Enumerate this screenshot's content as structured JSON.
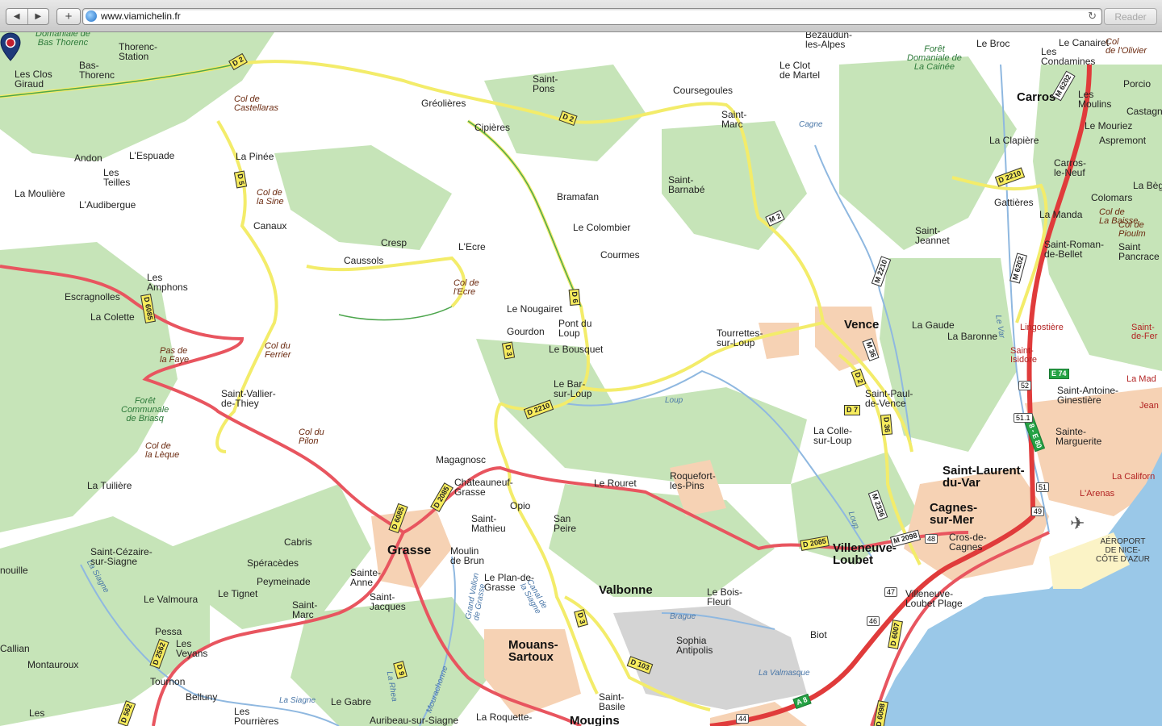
{
  "browser": {
    "back_icon": "back-arrow-icon",
    "forward_icon": "forward-arrow-icon",
    "add_label": "+",
    "url": "www.viamichelin.fr",
    "reload_icon": "reload-icon",
    "reader_label": "Reader"
  },
  "colors": {
    "land": "#ffffff",
    "forest": "#bfe0b0",
    "urban": "#f6d2b4",
    "sea": "#9ac8e8",
    "major_road": "#e8555f",
    "secondary_road": "#f3ec6a",
    "green_border": "#4da64d",
    "motorway": "#e03b3b"
  },
  "marker": {
    "icon": "map-pin-icon",
    "color": "#1e3a7a"
  },
  "towns": {
    "domaniale": "Domaniale de\nBas Thorenc",
    "thorenc_station": "Thorenc-\nStation",
    "bas_thorenc": "Bas-\nThorenc",
    "les_clos": "Les Clos\nGiraud",
    "greolieres": "Gréolières",
    "saint_pons": "Saint-\nPons",
    "coursegoules": "Coursegoules",
    "bezaudun": "Bezaudun-\nles-Alpes",
    "le_clot": "Le Clot\nde Martel",
    "le_broc": "Le Broc",
    "le_canairet": "Le Canairet",
    "les_condamines": "Les\nCondamines",
    "carros": "Carros",
    "les_moulins": "Les\nMoulins",
    "porcio": "Porcio",
    "castagn": "Castagn",
    "le_mouriez": "Le Mouriez",
    "aspremont": "Aspremont",
    "cipieres": "Cipières",
    "saint_marc_top": "Saint-\nMarc",
    "andon": "Andon",
    "lespuade": "L'Espuade",
    "les_teilles": "Les\nTeilles",
    "la_pinee": "La Pinée",
    "la_clapiere": "La Clapière",
    "carros_le_neuf": "Carros-\nle-Neuf",
    "saint_barnabe": "Saint-\nBarnabé",
    "bramafan": "Bramafan",
    "la_mouliere": "La Moulière",
    "laudibergue": "L'Audibergue",
    "gattieres": "Gattières",
    "la_bege": "La Bèg",
    "colomars": "Colomars",
    "la_manda": "La Manda",
    "canaux": "Canaux",
    "le_colombier": "Le Colombier",
    "cresp": "Cresp",
    "caussols": "Caussols",
    "lecre": "L'Ecre",
    "coursmes": "Courmes",
    "saint_jeannet": "Saint-\nJeannet",
    "saint_roman": "Saint-Roman-\nde-Bellet",
    "saint_pancrace": "Saint\nPancrace",
    "escragnolles": "Escragnolles",
    "les_amphons": "Les\nAmphons",
    "la_colette": "La Colette",
    "le_nougairet": "Le Nougairet",
    "gourdon": "Gourdon",
    "pont_du_loup": "Pont du\nLoup",
    "tourrettes": "Tourrettes-\nsur-Loup",
    "vence": "Vence",
    "la_gaude": "La Gaude",
    "la_baronne": "La Baronne",
    "le_bousquet": "Le Bousquet",
    "le_bar": "Le Bar-\nsur-Loup",
    "saint_vallier": "Saint-Vallier-\nde-Thiey",
    "saint_paul": "Saint-Paul-\nde-Vence",
    "saint_antoine": "Saint-Antoine-\nGinestière",
    "la_colle": "La Colle-\nsur-Loup",
    "sainte_marguerite": "Sainte-\nMarguerite",
    "magagnosc": "Magagnosc",
    "chateauneuf": "Châteauneuf-\nGrasse",
    "le_rouret": "Le Rouret",
    "roquefort": "Roquefort-\nles-Pins",
    "la_tuiliere": "La Tuilière",
    "saint_laurent": "Saint-Laurent-\ndu-Var",
    "opio": "Opio",
    "saint_mathieu": "Saint-\nMathieu",
    "san_peire": "San\nPeire",
    "cagnes": "Cagnes-\nsur-Mer",
    "cabris": "Cabris",
    "grasse": "Grasse",
    "moulin_de_brun": "Moulin\nde Brun",
    "villeneuve_loubet": "Villeneuve-\nLoubet",
    "cros_de_cagnes": "Cros-de-\nCagnes",
    "saint_cezaire": "Saint-Cézaire-\nsur-Siagne",
    "speracedes": "Spéracèdes",
    "peymeinade": "Peymeinade",
    "sainte_anne": "Sainte-\nAnne",
    "le_plan_de_grasse": "Le Plan-de-\nGrasse",
    "valbonne": "Valbonne",
    "le_bois_fleuri": "Le Bois-\nFleuri",
    "nouille": "nouille",
    "le_tignet": "Le Tignet",
    "le_valmoura": "Le Valmoura",
    "saint_jacques": "Saint-\nJacques",
    "saint_marc_bottom": "Saint-\nMarc",
    "villeneuve_loubet_plage": "Villeneuve-\nLoubet Plage",
    "pessa": "Pessa",
    "les_veyans": "Les\nVeyans",
    "callian": "Callian",
    "montauroux": "Montauroux",
    "mouans_sartoux": "Mouans-\nSartoux",
    "sophia": "Sophia\nAntipolis",
    "biot": "Biot",
    "tournon": "Tournon",
    "belluny": "Belluny",
    "le_gabre": "Le Gabre",
    "les_pourrieres": "Les\nPourrières",
    "les_bottom": "Les",
    "auribeau": "Auribeau-sur-Siagne",
    "la_roquette": "La Roquette-",
    "mougins": "Mougins",
    "saint_basile": "Saint-\nBasile",
    "larenas": "L'Arenas",
    "la_californie": "La Californ",
    "la_madeleine": "La Mad",
    "jean": "Jean",
    "saint_isidore": "Saint-\nIsidore",
    "lingostiere": "Lingostière",
    "saint_ferreol": "Saint-\nde-Fer"
  },
  "passes": {
    "castellaras": "Col de\nCastellaras",
    "la_sine": "Col de\nla Sine",
    "lecre": "Col de\nl'Ecre",
    "ferrier": "Col du\nFerrier",
    "pas_de_la_faye": "Pas de\nla Faye",
    "pilon": "Col du\nPilon",
    "la_leque": "Col de\nla Lèque",
    "la_baisse": "Col de\nLa Baisse",
    "piolm": "Col de\nPioulm",
    "olivier": "Col\nde l'Olivier"
  },
  "forests": {
    "bas_thorenc": "Domaniale de\nBas Thorenc",
    "cainee": "Forêt\nDomaniale de\nLa Cainée",
    "briasq": "Forêt\nCommunale\nde Briasq"
  },
  "water": {
    "cagne": "Cagne",
    "loup": "Loup",
    "le_var": "Le Var",
    "la_siagne": "La Siagne",
    "la_siagne2": "La Siagne",
    "la_brague": "Brague",
    "la_valmasque": "La Valmasque",
    "grand_vallon": "Grand Vallon\nde Grasse",
    "canal": "Canal de\nla Siagne",
    "mourachonne": "Mourachonne",
    "le_loup2": "Loup",
    "la_rhea": "La Rhea"
  },
  "airport": "AÉROPORT\nDE NICE-\nCÔTE D'AZUR",
  "roads": {
    "d2_a": "D 2",
    "d2_b": "D 2",
    "d5": "D 5",
    "m2": "M 2",
    "m2210": "M 2210",
    "d6085": "D 6085",
    "d6": "D 6",
    "d3": "D 3",
    "d2210": "D 2210",
    "m36": "M 36",
    "d2_c": "D 2",
    "d7": "D 7",
    "d36": "D 36",
    "d2085": "D 2085",
    "m2098": "M 2098",
    "m2336": "M 2336",
    "d6085b": "D 6085",
    "d2085b": "D 2085",
    "d2085c": "D 2085",
    "d3b": "D 3",
    "d103": "D 103",
    "d2562": "D 2562",
    "d9": "D 9",
    "d6007": "D 6007",
    "d6098": "D 6098",
    "d2210b": "D 2210",
    "m6202": "M 6202",
    "m6202b": "M 6202",
    "a8": "A 8",
    "a8b": "A 8 - E 80",
    "e74": "E 74",
    "d562": "D 562"
  },
  "exits": [
    "52",
    "51.1",
    "51",
    "49",
    "48",
    "47",
    "46",
    "44"
  ]
}
